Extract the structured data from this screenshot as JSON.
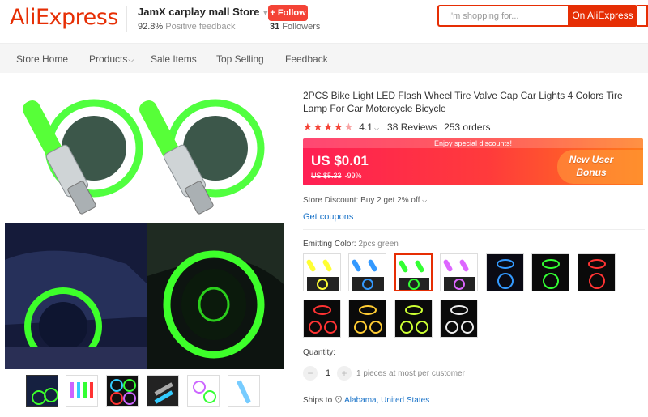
{
  "header": {
    "logo": "AliExpress",
    "store_name": "JamX carplay mall Store",
    "feedback_pct": "92.8%",
    "feedback_label": " Positive feedback",
    "follow_label": "+ Follow",
    "followers_count": "31",
    "followers_label": " Followers",
    "search_placeholder": "I'm shopping for...",
    "search_button": "On AliExpress"
  },
  "nav": {
    "items": [
      "Store Home",
      "Products",
      "Sale Items",
      "Top Selling",
      "Feedback"
    ]
  },
  "product": {
    "title": "2PCS Bike Light LED Flash Wheel Tire Valve Cap Car Lights 4 Colors Tire Lamp For Car Motorcycle Bicycle",
    "rating": "4.1",
    "rating_value": 4.1,
    "reviews": "38 Reviews",
    "orders": "253 orders",
    "promo_banner": "Enjoy special discounts!",
    "price": "US $0.01",
    "old_price": "US $5.33",
    "discount_pct": "-99%",
    "badge_line1": "New User",
    "badge_line2": "Bonus",
    "store_discount": "Store Discount: Buy 2 get 2% off",
    "coupons": "Get coupons",
    "emitting_label": "Emitting Color:",
    "emitting_value": "2pcs green",
    "quantity_label": "Quantity:",
    "quantity": "1",
    "quantity_note": "1 pieces at most per customer",
    "ships_label": "Ships to",
    "ships_location": "Alabama, United States"
  },
  "colors": {
    "brand": "#e62e04",
    "accent_red": "#f44336",
    "link": "#1a73c8",
    "green_glow": "#3dff2a"
  }
}
